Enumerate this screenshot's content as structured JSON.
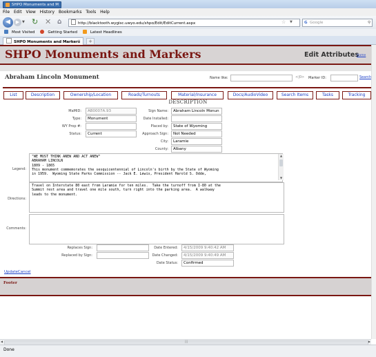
{
  "window": {
    "title": "SHPO Monuments and M"
  },
  "menu": [
    "File",
    "Edit",
    "View",
    "History",
    "Bookmarks",
    "Tools",
    "Help"
  ],
  "browser": {
    "url": "http://blacktooth.wygisc.uwyo.edu/shpo/Edit/EditCurrent.aspx",
    "search_placeholder": "Google"
  },
  "bookmarks": [
    {
      "label": "Most Visited",
      "icon": "most-visited-icon"
    },
    {
      "label": "Getting Started",
      "icon": "firefox-icon"
    },
    {
      "label": "Latest Headlines",
      "icon": "rss-icon"
    }
  ],
  "tab": {
    "label": "SHPO Monuments and Markers"
  },
  "header": {
    "site_title": "SHPO Monuments and Markers",
    "page_title": "Edit Attributes",
    "home_link": "Home"
  },
  "record": {
    "name": "Abraham Lincoln Monument"
  },
  "finder": {
    "name_like_label": "Name like:",
    "arrows": "<|0>",
    "marker_id_label": "Marker ID:",
    "search_link": "Search"
  },
  "nav": [
    "List",
    "Description",
    "Ownership/Location",
    "Roads/Turnouts",
    "Material/Insurance",
    "Docs/AudioVideo",
    "Search Items",
    "Tasks",
    "Tracking"
  ],
  "section": {
    "title": "DESCRIPTION"
  },
  "fields": {
    "mmid": {
      "label": "MaMID:",
      "value": "AB0007A.93"
    },
    "type": {
      "label": "Type:",
      "value": "Monument"
    },
    "wyprop": {
      "label": "WY Prop #:",
      "value": ""
    },
    "status": {
      "label": "Status:",
      "value": "Current"
    },
    "sign_name": {
      "label": "Sign Name:",
      "value": "Abraham Lincoln Monun"
    },
    "date_installed": {
      "label": "Date Installed:",
      "value": ""
    },
    "placed_by": {
      "label": "Placed by:",
      "value": "State of Wyoming"
    },
    "approach_sign": {
      "label": "Approach Sign:",
      "value": "Not Needed"
    },
    "city": {
      "label": "City:",
      "value": "Laramie"
    },
    "county": {
      "label": "County:",
      "value": "Albany"
    }
  },
  "legend": {
    "label": "Legend:",
    "text": "\"WE MUST THINK ANEW AND ACT ANEW\"\nABRAHAM LINCOLN\n1809 - 1865\nThis monument commemorates the sesquicentennial of Lincoln's birth by the State of Wyoming\nin 1959.  Wyoming State Parks Commission -- Jack E. Lewis, President Harold S. Odde,"
  },
  "directions": {
    "label": "Directions:",
    "text": "Travel on Interstate 80 east from Laramie for ten miles.  Take the turnoff from I-80 at the\nSummit rest area and travel one mile south, turn right into the parking area.  A walkway\nleads to the monument."
  },
  "comments": {
    "label": "Comments:",
    "text": ""
  },
  "bottom": {
    "replaces_sign": {
      "label": "Replaces Sign:",
      "value": ""
    },
    "replaced_by_sign": {
      "label": "Replaced by Sign:",
      "value": ""
    },
    "date_entered": {
      "label": "Date Entered:",
      "value": "4/15/2009 9:40:42 AM"
    },
    "date_changed": {
      "label": "Date Changed:",
      "value": "4/15/2009 9:40:49 AM"
    },
    "date_status": {
      "label": "Date Status:",
      "value": "Confirmed"
    }
  },
  "actions": {
    "update_cancel": "UpdateCancel"
  },
  "footer": {
    "text": "Footer"
  },
  "status": {
    "text": "Done"
  },
  "colors": {
    "accent": "#7a1712",
    "link": "#1a3ec7",
    "band": "#d8d4d4"
  }
}
